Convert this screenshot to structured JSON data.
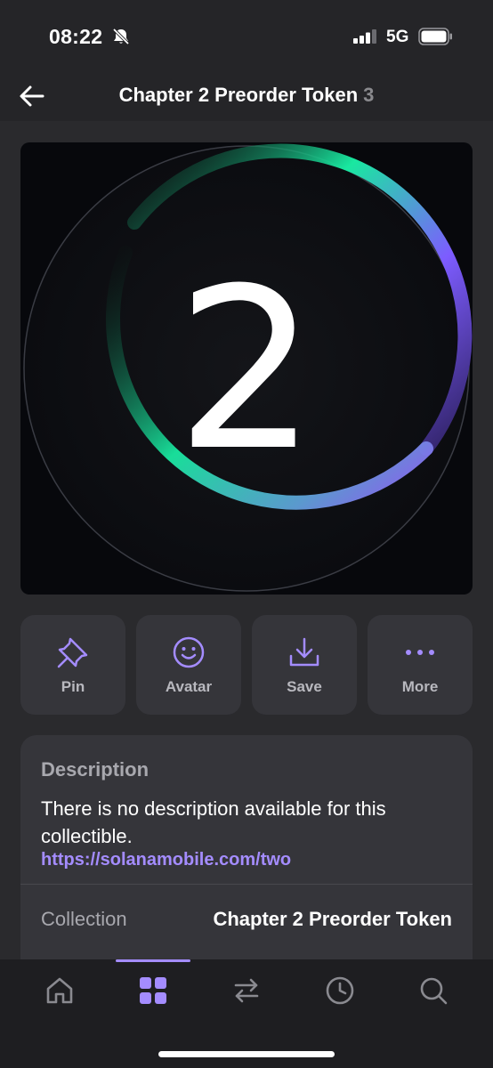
{
  "status_bar": {
    "time": "08:22",
    "network": "5G"
  },
  "header": {
    "title": "Chapter 2 Preorder Token",
    "count": "3"
  },
  "artwork": {
    "numeral": "2"
  },
  "actions": [
    {
      "label": "Pin",
      "icon": "pin-icon"
    },
    {
      "label": "Avatar",
      "icon": "smiley-icon"
    },
    {
      "label": "Save",
      "icon": "download-icon"
    },
    {
      "label": "More",
      "icon": "ellipsis-icon"
    }
  ],
  "description": {
    "heading": "Description",
    "text": "There is no description available for this collectible.",
    "link": "https://solanamobile.com/two"
  },
  "collection": {
    "label": "Collection",
    "value": "Chapter 2 Preorder Token"
  },
  "tabs": [
    {
      "name": "home",
      "icon": "home-icon",
      "active": false
    },
    {
      "name": "collectibles",
      "icon": "grid-icon",
      "active": true
    },
    {
      "name": "swap",
      "icon": "swap-icon",
      "active": false
    },
    {
      "name": "activity",
      "icon": "clock-icon",
      "active": false
    },
    {
      "name": "search",
      "icon": "search-icon",
      "active": false
    }
  ],
  "colors": {
    "accent": "#a48cff",
    "background": "#252528",
    "card": "#35353a",
    "muted_text": "#a8a8ae"
  }
}
